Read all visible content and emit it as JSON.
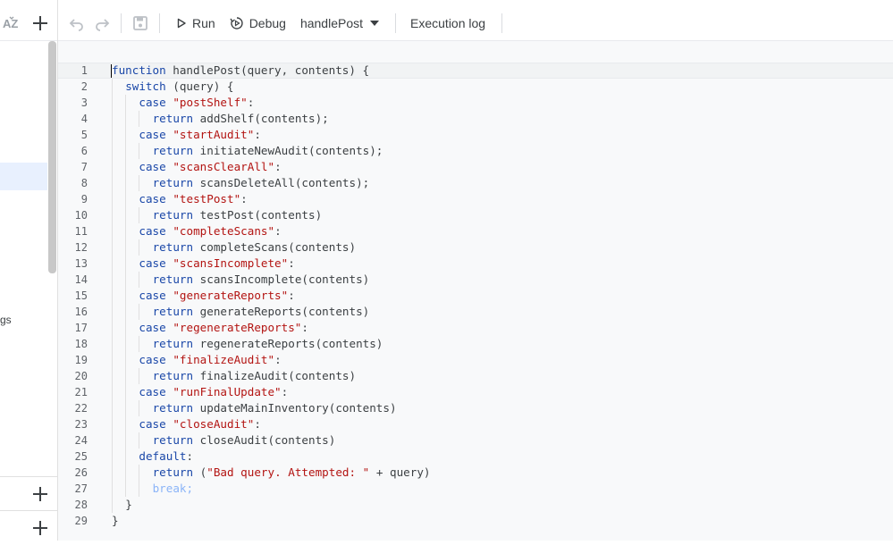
{
  "toolbar": {
    "run_label": "Run",
    "debug_label": "Debug",
    "function_select": "handlePost",
    "execution_log_label": "Execution log"
  },
  "sidebar": {
    "truncated_label": "gs"
  },
  "editor": {
    "lines": [
      {
        "n": "1",
        "indent": 0,
        "tokens": [
          {
            "t": "kw",
            "v": "function"
          },
          {
            "t": "p",
            "v": " handlePost(query, contents) {"
          }
        ]
      },
      {
        "n": "2",
        "indent": 1,
        "tokens": [
          {
            "t": "kw",
            "v": "switch"
          },
          {
            "t": "p",
            "v": " (query) {"
          }
        ]
      },
      {
        "n": "3",
        "indent": 2,
        "tokens": [
          {
            "t": "kw",
            "v": "case"
          },
          {
            "t": "p",
            "v": " "
          },
          {
            "t": "str",
            "v": "\"postShelf\""
          },
          {
            "t": "p",
            "v": ":"
          }
        ]
      },
      {
        "n": "4",
        "indent": 3,
        "tokens": [
          {
            "t": "kw",
            "v": "return"
          },
          {
            "t": "p",
            "v": " addShelf(contents);"
          }
        ]
      },
      {
        "n": "5",
        "indent": 2,
        "tokens": [
          {
            "t": "kw",
            "v": "case"
          },
          {
            "t": "p",
            "v": " "
          },
          {
            "t": "str",
            "v": "\"startAudit\""
          },
          {
            "t": "p",
            "v": ":"
          }
        ]
      },
      {
        "n": "6",
        "indent": 3,
        "tokens": [
          {
            "t": "kw",
            "v": "return"
          },
          {
            "t": "p",
            "v": " initiateNewAudit(contents);"
          }
        ]
      },
      {
        "n": "7",
        "indent": 2,
        "tokens": [
          {
            "t": "kw",
            "v": "case"
          },
          {
            "t": "p",
            "v": " "
          },
          {
            "t": "str",
            "v": "\"scansClearAll\""
          },
          {
            "t": "p",
            "v": ":"
          }
        ]
      },
      {
        "n": "8",
        "indent": 3,
        "tokens": [
          {
            "t": "kw",
            "v": "return"
          },
          {
            "t": "p",
            "v": " scansDeleteAll(contents);"
          }
        ]
      },
      {
        "n": "9",
        "indent": 2,
        "tokens": [
          {
            "t": "kw",
            "v": "case"
          },
          {
            "t": "p",
            "v": " "
          },
          {
            "t": "str",
            "v": "\"testPost\""
          },
          {
            "t": "p",
            "v": ":"
          }
        ]
      },
      {
        "n": "10",
        "indent": 3,
        "tokens": [
          {
            "t": "kw",
            "v": "return"
          },
          {
            "t": "p",
            "v": " testPost(contents)"
          }
        ]
      },
      {
        "n": "11",
        "indent": 2,
        "tokens": [
          {
            "t": "kw",
            "v": "case"
          },
          {
            "t": "p",
            "v": " "
          },
          {
            "t": "str",
            "v": "\"completeScans\""
          },
          {
            "t": "p",
            "v": ":"
          }
        ]
      },
      {
        "n": "12",
        "indent": 3,
        "tokens": [
          {
            "t": "kw",
            "v": "return"
          },
          {
            "t": "p",
            "v": " completeScans(contents)"
          }
        ]
      },
      {
        "n": "13",
        "indent": 2,
        "tokens": [
          {
            "t": "kw",
            "v": "case"
          },
          {
            "t": "p",
            "v": " "
          },
          {
            "t": "str",
            "v": "\"scansIncomplete\""
          },
          {
            "t": "p",
            "v": ":"
          }
        ]
      },
      {
        "n": "14",
        "indent": 3,
        "tokens": [
          {
            "t": "kw",
            "v": "return"
          },
          {
            "t": "p",
            "v": " scansIncomplete(contents)"
          }
        ]
      },
      {
        "n": "15",
        "indent": 2,
        "tokens": [
          {
            "t": "kw",
            "v": "case"
          },
          {
            "t": "p",
            "v": " "
          },
          {
            "t": "str",
            "v": "\"generateReports\""
          },
          {
            "t": "p",
            "v": ":"
          }
        ]
      },
      {
        "n": "16",
        "indent": 3,
        "tokens": [
          {
            "t": "kw",
            "v": "return"
          },
          {
            "t": "p",
            "v": " generateReports(contents)"
          }
        ]
      },
      {
        "n": "17",
        "indent": 2,
        "tokens": [
          {
            "t": "kw",
            "v": "case"
          },
          {
            "t": "p",
            "v": " "
          },
          {
            "t": "str",
            "v": "\"regenerateReports\""
          },
          {
            "t": "p",
            "v": ":"
          }
        ]
      },
      {
        "n": "18",
        "indent": 3,
        "tokens": [
          {
            "t": "kw",
            "v": "return"
          },
          {
            "t": "p",
            "v": " regenerateReports(contents)"
          }
        ]
      },
      {
        "n": "19",
        "indent": 2,
        "tokens": [
          {
            "t": "kw",
            "v": "case"
          },
          {
            "t": "p",
            "v": " "
          },
          {
            "t": "str",
            "v": "\"finalizeAudit\""
          },
          {
            "t": "p",
            "v": ":"
          }
        ]
      },
      {
        "n": "20",
        "indent": 3,
        "tokens": [
          {
            "t": "kw",
            "v": "return"
          },
          {
            "t": "p",
            "v": " finalizeAudit(contents)"
          }
        ]
      },
      {
        "n": "21",
        "indent": 2,
        "tokens": [
          {
            "t": "kw",
            "v": "case"
          },
          {
            "t": "p",
            "v": " "
          },
          {
            "t": "str",
            "v": "\"runFinalUpdate\""
          },
          {
            "t": "p",
            "v": ":"
          }
        ]
      },
      {
        "n": "22",
        "indent": 3,
        "tokens": [
          {
            "t": "kw",
            "v": "return"
          },
          {
            "t": "p",
            "v": " updateMainInventory(contents)"
          }
        ]
      },
      {
        "n": "23",
        "indent": 2,
        "tokens": [
          {
            "t": "kw",
            "v": "case"
          },
          {
            "t": "p",
            "v": " "
          },
          {
            "t": "str",
            "v": "\"closeAudit\""
          },
          {
            "t": "p",
            "v": ":"
          }
        ]
      },
      {
        "n": "24",
        "indent": 3,
        "tokens": [
          {
            "t": "kw",
            "v": "return"
          },
          {
            "t": "p",
            "v": " closeAudit(contents)"
          }
        ]
      },
      {
        "n": "25",
        "indent": 2,
        "tokens": [
          {
            "t": "kw",
            "v": "default"
          },
          {
            "t": "p",
            "v": ":"
          }
        ]
      },
      {
        "n": "26",
        "indent": 3,
        "tokens": [
          {
            "t": "kw",
            "v": "return"
          },
          {
            "t": "p",
            "v": " ("
          },
          {
            "t": "str",
            "v": "\"Bad query. Attempted: \""
          },
          {
            "t": "p",
            "v": " + query)"
          }
        ]
      },
      {
        "n": "27",
        "indent": 3,
        "tokens": [
          {
            "t": "cmt",
            "v": "break;"
          }
        ]
      },
      {
        "n": "28",
        "indent": 1,
        "tokens": [
          {
            "t": "p",
            "v": "}"
          }
        ]
      },
      {
        "n": "29",
        "indent": 0,
        "tokens": [
          {
            "t": "p",
            "v": "}"
          }
        ]
      }
    ]
  }
}
